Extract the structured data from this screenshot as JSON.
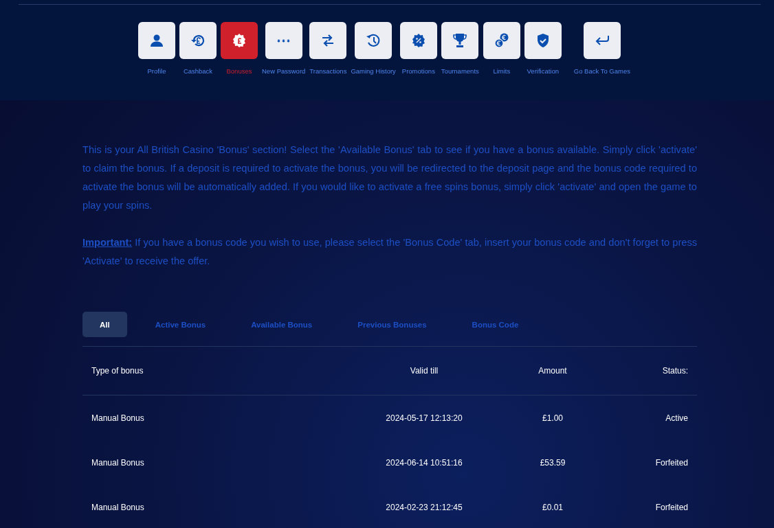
{
  "account_menu": [
    {
      "label": "Profile",
      "kind": "profile",
      "selected": false
    },
    {
      "label": "Cashback",
      "kind": "cashback",
      "selected": false
    },
    {
      "label": "Bonuses",
      "kind": "bonus",
      "selected": true
    },
    {
      "label": "New Password",
      "kind": "password",
      "selected": false
    },
    {
      "label": "Transactions",
      "kind": "transactions",
      "selected": false
    },
    {
      "label": "Gaming History",
      "kind": "history",
      "selected": false
    },
    {
      "label": "Promotions",
      "kind": "promotions",
      "selected": false
    },
    {
      "label": "Tournaments",
      "kind": "trophy",
      "selected": false
    },
    {
      "label": "Limits",
      "kind": "limits",
      "selected": false
    },
    {
      "label": "Verification",
      "kind": "verification",
      "selected": false
    },
    {
      "label": "Go Back To Games",
      "kind": "back",
      "selected": false
    }
  ],
  "intro": [
    "This is your All British Casino 'Bonus' section!  Select the 'Available Bonus' tab to see if you have a bonus available. Simply click 'activate' to claim the bonus. If a deposit is required to activate the bonus, you will be redirected to the deposit page and the bonus code required to activate the bonus will be automatically added. If you would like to activate a free spins bonus, simply click 'activate' and open the game to play your spins.",
    "**Important:** If you have a bonus code you wish to use, please select the 'Bonus Code' tab, insert your bonus code and don't forget to press 'Activate' to receive the offer."
  ],
  "tabs": [
    {
      "label": "All",
      "selected": true
    },
    {
      "label": "Active Bonus",
      "selected": false
    },
    {
      "label": "Available Bonus",
      "selected": false
    },
    {
      "label": "Previous Bonuses",
      "selected": false
    },
    {
      "label": "Bonus Code",
      "selected": false
    }
  ],
  "table": {
    "columns": [
      "Type of bonus",
      "Valid till",
      "Amount",
      "Status:"
    ],
    "rows": [
      [
        "Manual Bonus",
        "2024-05-17 12:13:20",
        "£1.00",
        "Active"
      ],
      [
        "Manual Bonus",
        "2024-06-14 10:51:16",
        "£53.59",
        "Forfeited"
      ],
      [
        "Manual Bonus",
        "2024-02-23 21:12:45",
        "£0.01",
        "Forfeited"
      ]
    ]
  }
}
